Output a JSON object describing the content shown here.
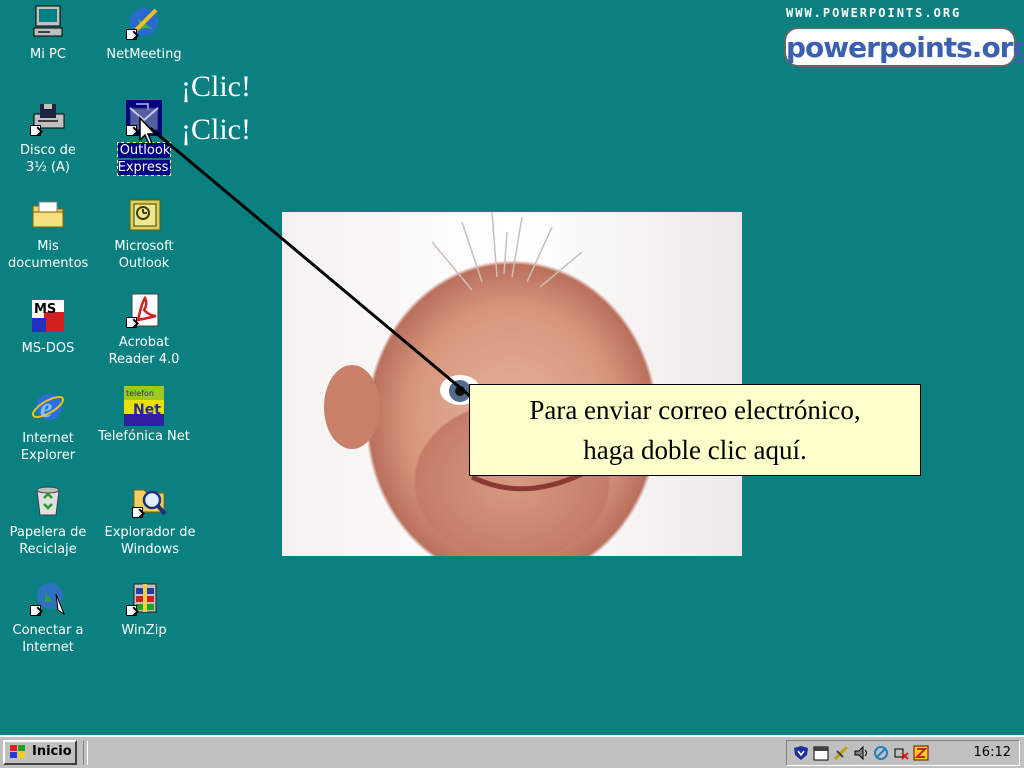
{
  "desktop": {
    "icons": [
      {
        "id": "mi-pc",
        "label": "Mi PC"
      },
      {
        "id": "netmeeting",
        "label": "NetMeeting"
      },
      {
        "id": "disco",
        "label": "Disco de 3½ (A)"
      },
      {
        "id": "outlook-express",
        "label": "Outlook Express"
      },
      {
        "id": "mis-documentos",
        "label": "Mis documentos"
      },
      {
        "id": "microsoft-outlook",
        "label": "Microsoft Outlook"
      },
      {
        "id": "ms-dos",
        "label": "MS-DOS"
      },
      {
        "id": "acrobat",
        "label": "Acrobat Reader 4.0"
      },
      {
        "id": "internet-explorer",
        "label": "Internet Explorer"
      },
      {
        "id": "telefonica-net",
        "label": "Telefónica Net"
      },
      {
        "id": "papelera",
        "label": "Papelera de Reciclaje"
      },
      {
        "id": "explorador",
        "label": "Explorador de Windows"
      },
      {
        "id": "conectar",
        "label": "Conectar a Internet"
      },
      {
        "id": "winzip",
        "label": "WinZip"
      }
    ],
    "icon_text": {
      "ms_dos_glyph": "MS",
      "telefonica_glyph_top": "telefon",
      "telefonica_glyph": "Net"
    }
  },
  "annotation": {
    "clic_1": "¡Clic!",
    "clic_2": "¡Clic!",
    "callout_line1": "Para enviar correo electrónico,",
    "callout_line2": "haga doble clic aquí."
  },
  "watermark": {
    "url": "WWW.POWERPOINTS.ORG",
    "logo": "powerpoints.org"
  },
  "taskbar": {
    "start_label": "Inicio",
    "clock": "16:12"
  },
  "colors": {
    "desktop": "#008080",
    "callout_bg": "#ffffcc",
    "taskbar": "#c0c0c0",
    "selection": "#000080"
  }
}
